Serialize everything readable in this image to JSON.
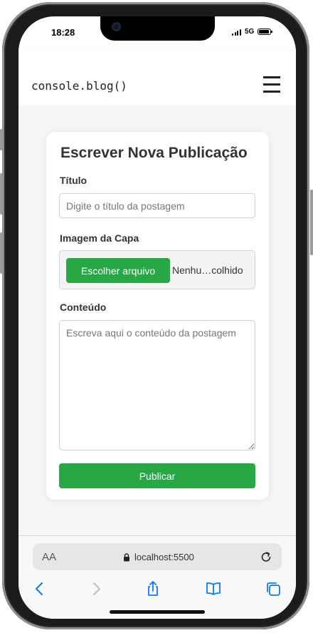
{
  "status": {
    "time": "18:28",
    "network": "5G"
  },
  "navbar": {
    "brand": "console.blog()"
  },
  "form": {
    "title": "Escrever Nova Publicação",
    "title_label": "Título",
    "title_placeholder": "Digite o título da postagem",
    "cover_label": "Imagem da Capa",
    "choose_file": "Escolher arquivo",
    "no_file": "Nenhu…colhido",
    "content_label": "Conteúdo",
    "content_placeholder": "Escreva aqui o conteúdo da postagem",
    "submit": "Publicar"
  },
  "browser": {
    "text_size": "AA",
    "url": "localhost:5500",
    "toolbar": [
      "back-icon",
      "forward-icon",
      "share-icon",
      "bookmarks-icon",
      "tabs-icon"
    ]
  },
  "colors": {
    "accent": "#28a745",
    "safari_blue": "#0a7aff"
  }
}
